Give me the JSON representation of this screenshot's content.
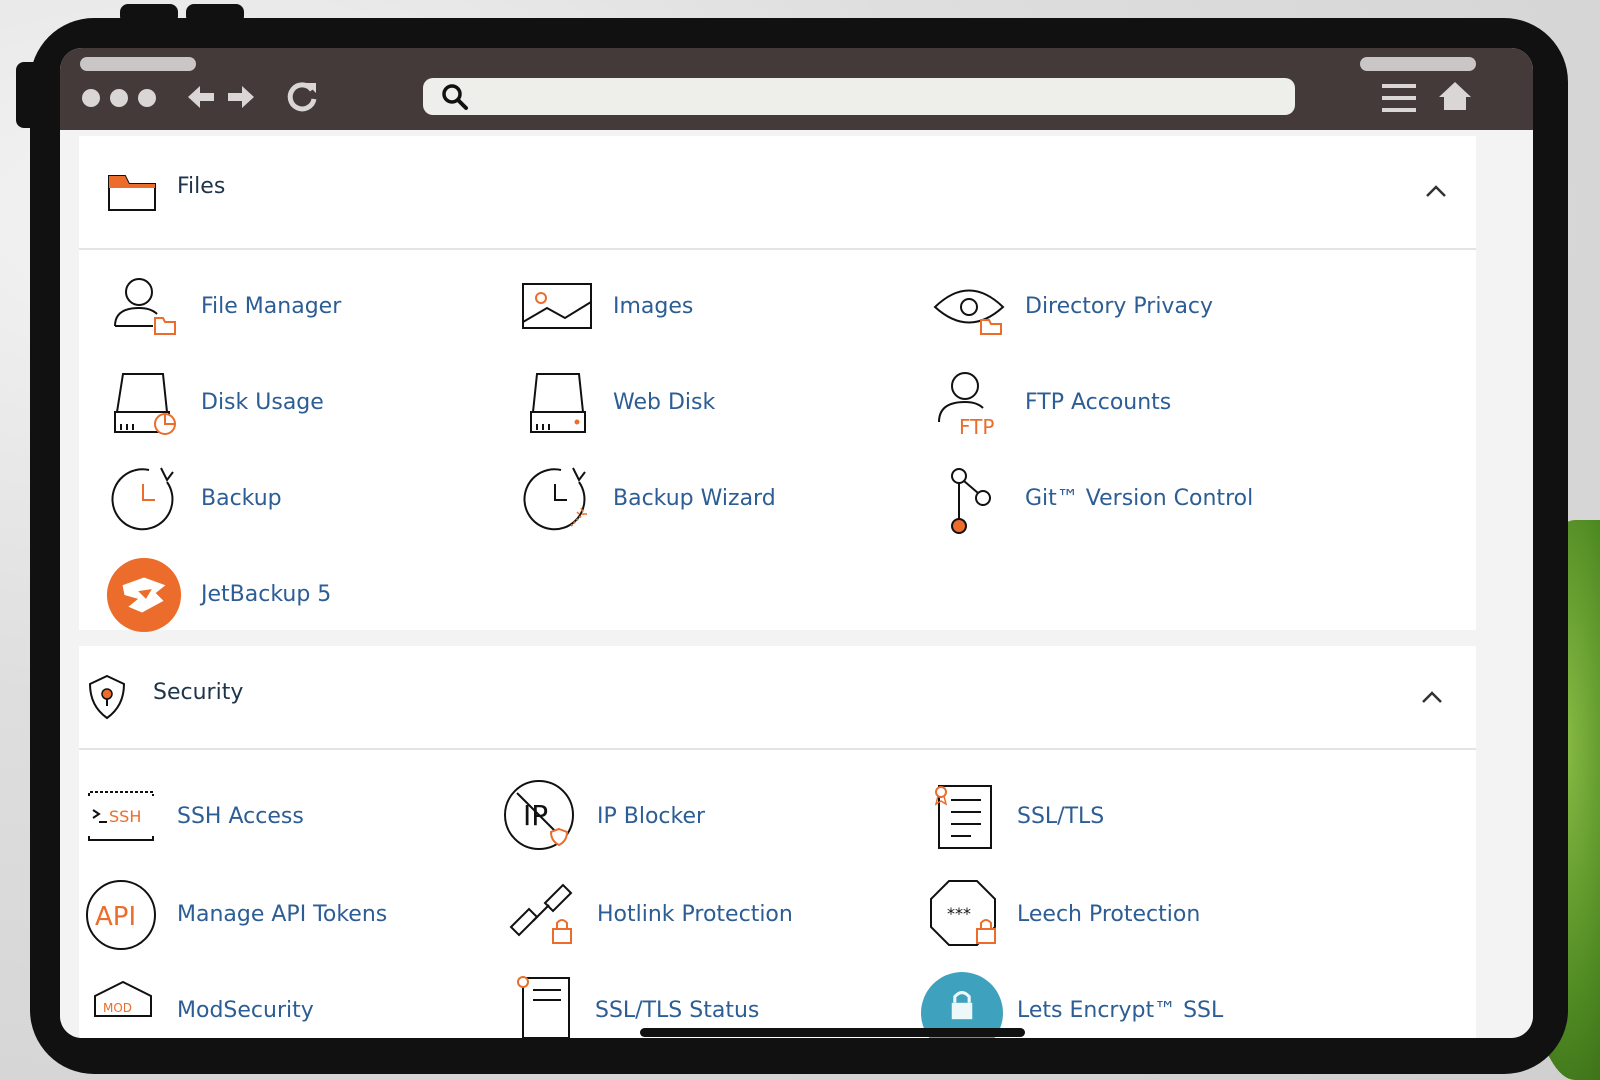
{
  "colors": {
    "accent": "#ec6d2b",
    "link": "#2c5d94",
    "chrome": "#433a39",
    "heading": "#1e3448"
  },
  "browser": {
    "search_placeholder": "",
    "icons": [
      "dots-icon",
      "back-icon",
      "forward-icon",
      "reload-icon",
      "search-icon",
      "menu-icon",
      "home-icon"
    ]
  },
  "files": {
    "title": "Files",
    "items": [
      {
        "label": "File Manager",
        "icon": "file-manager-icon"
      },
      {
        "label": "Images",
        "icon": "images-icon"
      },
      {
        "label": "Directory Privacy",
        "icon": "directory-privacy-icon"
      },
      {
        "label": "Disk Usage",
        "icon": "disk-usage-icon"
      },
      {
        "label": "Web Disk",
        "icon": "web-disk-icon"
      },
      {
        "label": "FTP Accounts",
        "icon": "ftp-accounts-icon"
      },
      {
        "label": "Backup",
        "icon": "backup-icon"
      },
      {
        "label": "Backup Wizard",
        "icon": "backup-wizard-icon"
      },
      {
        "label": "Git™ Version Control",
        "icon": "git-icon"
      },
      {
        "label": "JetBackup 5",
        "icon": "jetbackup-icon"
      }
    ]
  },
  "security": {
    "title": "Security",
    "items": [
      {
        "label": "SSH Access",
        "icon": "ssh-icon"
      },
      {
        "label": "IP Blocker",
        "icon": "ip-blocker-icon"
      },
      {
        "label": "SSL/TLS",
        "icon": "ssl-tls-icon"
      },
      {
        "label": "Manage API Tokens",
        "icon": "api-tokens-icon"
      },
      {
        "label": "Hotlink Protection",
        "icon": "hotlink-icon"
      },
      {
        "label": "Leech Protection",
        "icon": "leech-icon"
      },
      {
        "label": "ModSecurity",
        "icon": "modsecurity-icon"
      },
      {
        "label": "SSL/TLS Status",
        "icon": "ssl-status-icon"
      },
      {
        "label": "Lets Encrypt™ SSL",
        "icon": "letsencrypt-icon"
      }
    ]
  }
}
